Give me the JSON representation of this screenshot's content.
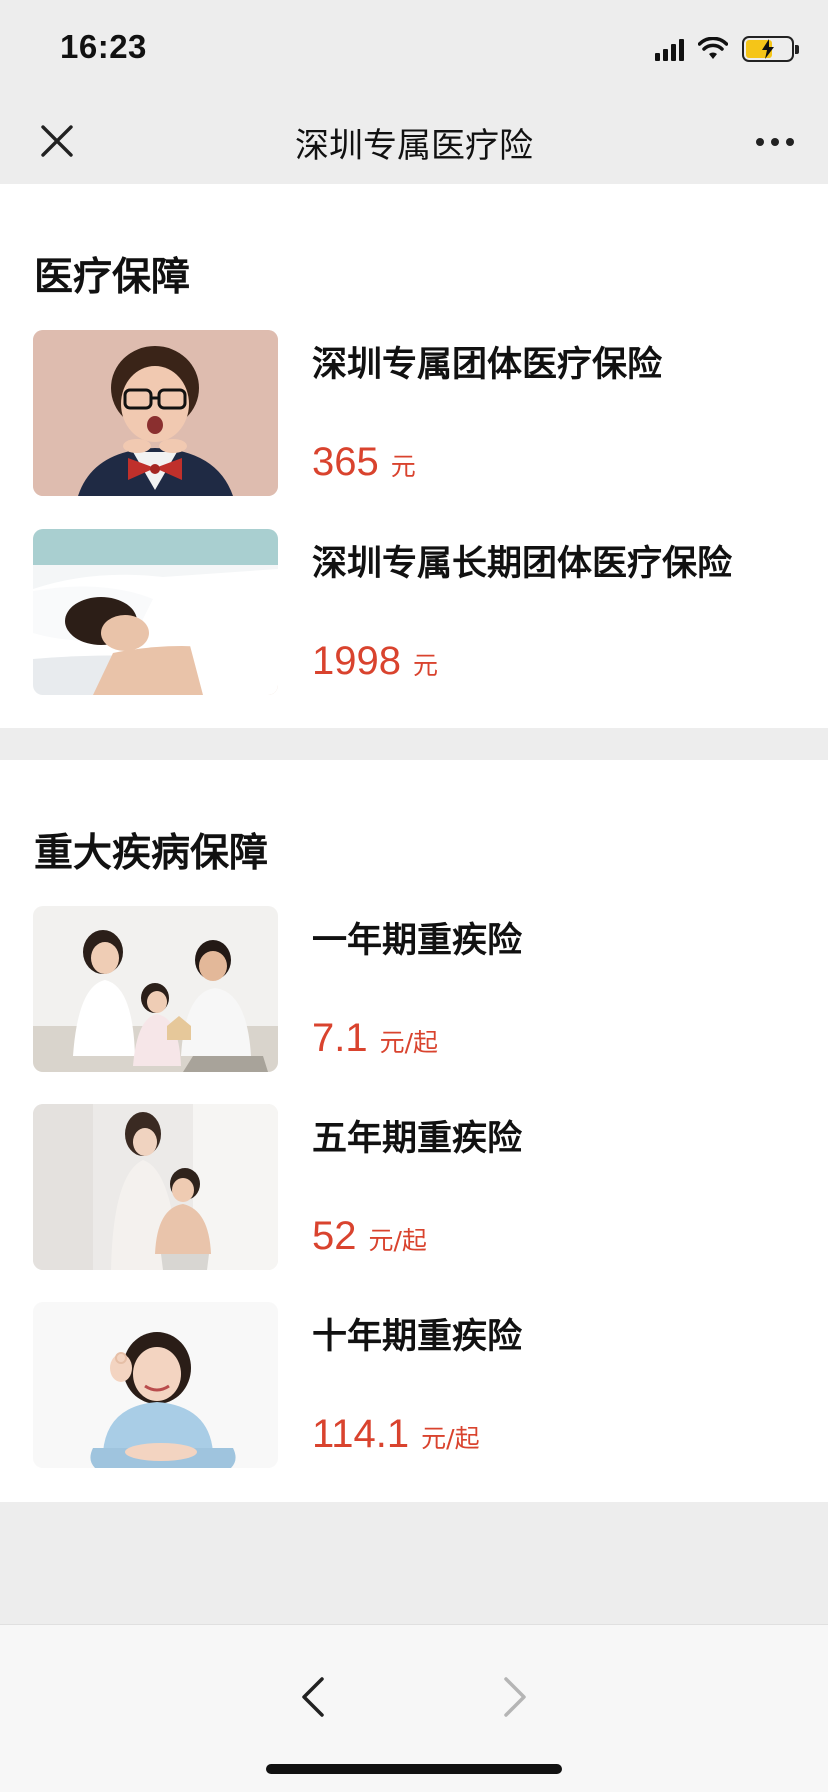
{
  "status_bar": {
    "time": "16:23"
  },
  "nav": {
    "title": "深圳专属医疗险"
  },
  "sections": [
    {
      "title": "医疗保障",
      "items": [
        {
          "name": "深圳专属团体医疗保险",
          "price": "365",
          "unit": "元",
          "image": "boy-with-glasses-photo"
        },
        {
          "name": "深圳专属长期团体医疗保险",
          "price": "1998",
          "unit": "元",
          "image": "sleeping-woman-photo"
        }
      ]
    },
    {
      "title": "重大疾病保障",
      "items": [
        {
          "name": "一年期重疾险",
          "price": "7.1",
          "unit": "元/起",
          "image": "family-on-sofa-photo"
        },
        {
          "name": "五年期重疾险",
          "price": "52",
          "unit": "元/起",
          "image": "mother-and-child-photo"
        },
        {
          "name": "十年期重疾险",
          "price": "114.1",
          "unit": "元/起",
          "image": "smiling-woman-ok-photo"
        }
      ]
    }
  ],
  "colors": {
    "price": "#d9432e",
    "background": "#ededed",
    "card": "#ffffff"
  }
}
